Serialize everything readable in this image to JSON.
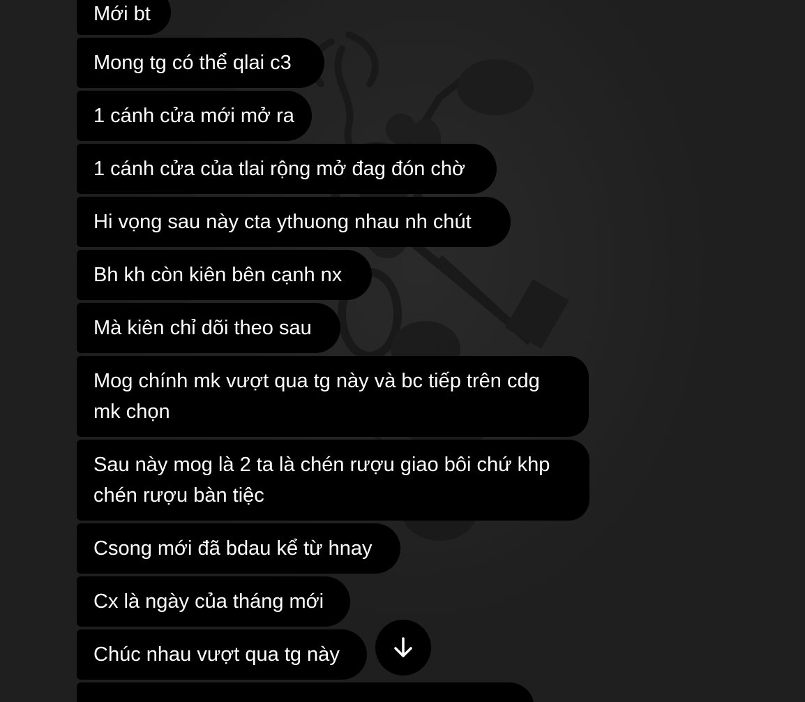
{
  "messages": [
    "Mới bt",
    "Mong tg có thể qlai c3",
    "1 cánh cửa mới mở ra",
    "1 cánh cửa của tlai rộng mở đag đón chờ",
    "Hi vọng sau này cta ythuong nhau nh chút",
    "Bh kh còn kiên bên cạnh nx",
    "Mà kiên chỉ dõi theo sau",
    "Mog chính mk vượt qua tg này và bc tiếp trên cdg\nmk chọn",
    "Sau này mog là 2 ta là chén rượu giao bôi chứ khp\nchén rượu bàn tiệc",
    "Csong mới đã bdau kể từ hnay",
    "Cx là ngày của tháng mới",
    "Chúc nhau vượt qua tg này",
    ""
  ],
  "scroll_button_icon": "arrow-down-icon",
  "colors": {
    "background": "#262626",
    "bubble": "#000000",
    "text": "#ffffff"
  }
}
